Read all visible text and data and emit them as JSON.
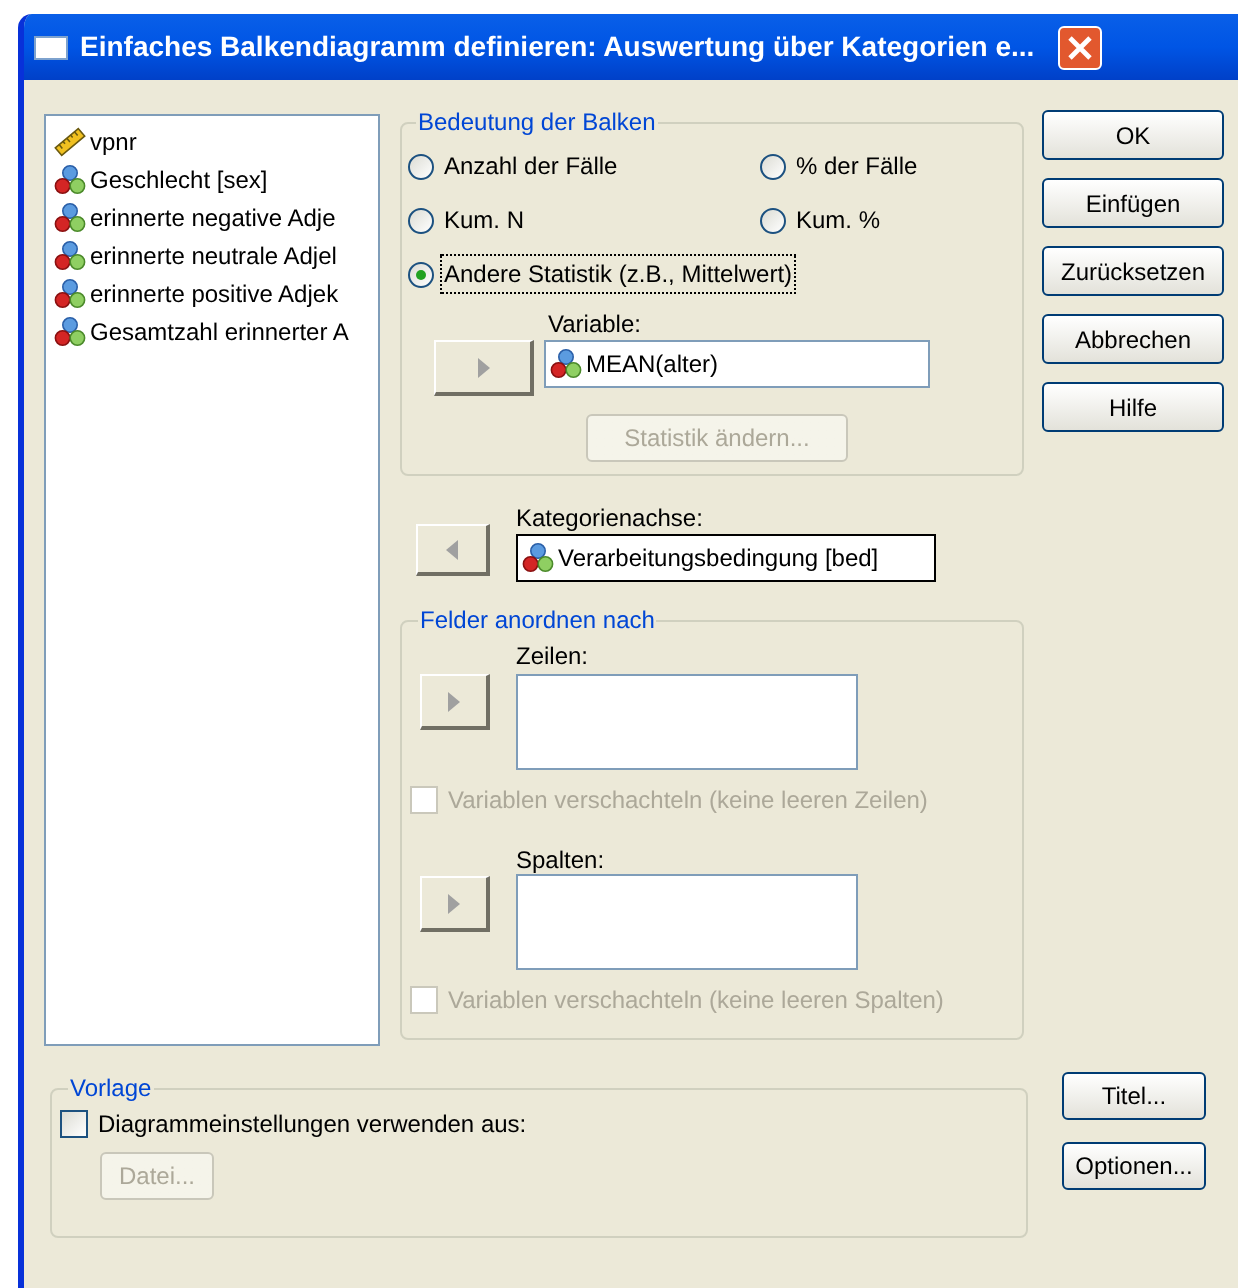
{
  "window": {
    "title": "Einfaches Balkendiagramm definieren: Auswertung über Kategorien e..."
  },
  "variables": [
    {
      "kind": "scale",
      "label": "vpnr"
    },
    {
      "kind": "nominal",
      "label": "Geschlecht [sex]"
    },
    {
      "kind": "nominal",
      "label": "erinnerte negative Adje"
    },
    {
      "kind": "nominal",
      "label": "erinnerte neutrale Adjel"
    },
    {
      "kind": "nominal",
      "label": "erinnerte positive Adjek"
    },
    {
      "kind": "nominal",
      "label": "Gesamtzahl erinnerter A"
    }
  ],
  "meaning_group": {
    "legend": "Bedeutung der Balken",
    "options": [
      {
        "label": "Anzahl der Fälle",
        "selected": false,
        "focused": false
      },
      {
        "label": "% der Fälle",
        "selected": false,
        "focused": false
      },
      {
        "label": "Kum. N",
        "selected": false,
        "focused": false
      },
      {
        "label": "Kum. %",
        "selected": false,
        "focused": false
      },
      {
        "label": "Andere Statistik (z.B., Mittelwert)",
        "selected": true,
        "focused": true
      }
    ],
    "variable_label": "Variable:",
    "variable_value": "MEAN(alter)",
    "change_statistic_button": {
      "label": "Statistik ändern...",
      "disabled": true
    }
  },
  "category_axis": {
    "label": "Kategorienachse:",
    "value": "Verarbeitungsbedingung [bed]"
  },
  "panels_group": {
    "legend": "Felder anordnen nach",
    "rows_label": "Zeilen:",
    "rows_nest": {
      "label": "Variablen verschachteln (keine leeren Zeilen)",
      "checked": false,
      "disabled": true
    },
    "columns_label": "Spalten:",
    "columns_nest": {
      "label": "Variablen verschachteln (keine leeren Spalten)",
      "checked": false,
      "disabled": true
    }
  },
  "template_group": {
    "legend": "Vorlage",
    "use_template": {
      "label": "Diagrammeinstellungen verwenden aus:",
      "checked": false
    },
    "file_button": {
      "label": "Datei...",
      "disabled": true
    }
  },
  "buttons": [
    {
      "label": "OK"
    },
    {
      "label": "Einfügen"
    },
    {
      "label": "Zurücksetzen"
    },
    {
      "label": "Abbrechen"
    },
    {
      "label": "Hilfe"
    }
  ],
  "bottom_buttons": [
    {
      "label": "Titel..."
    },
    {
      "label": "Optionen..."
    }
  ]
}
